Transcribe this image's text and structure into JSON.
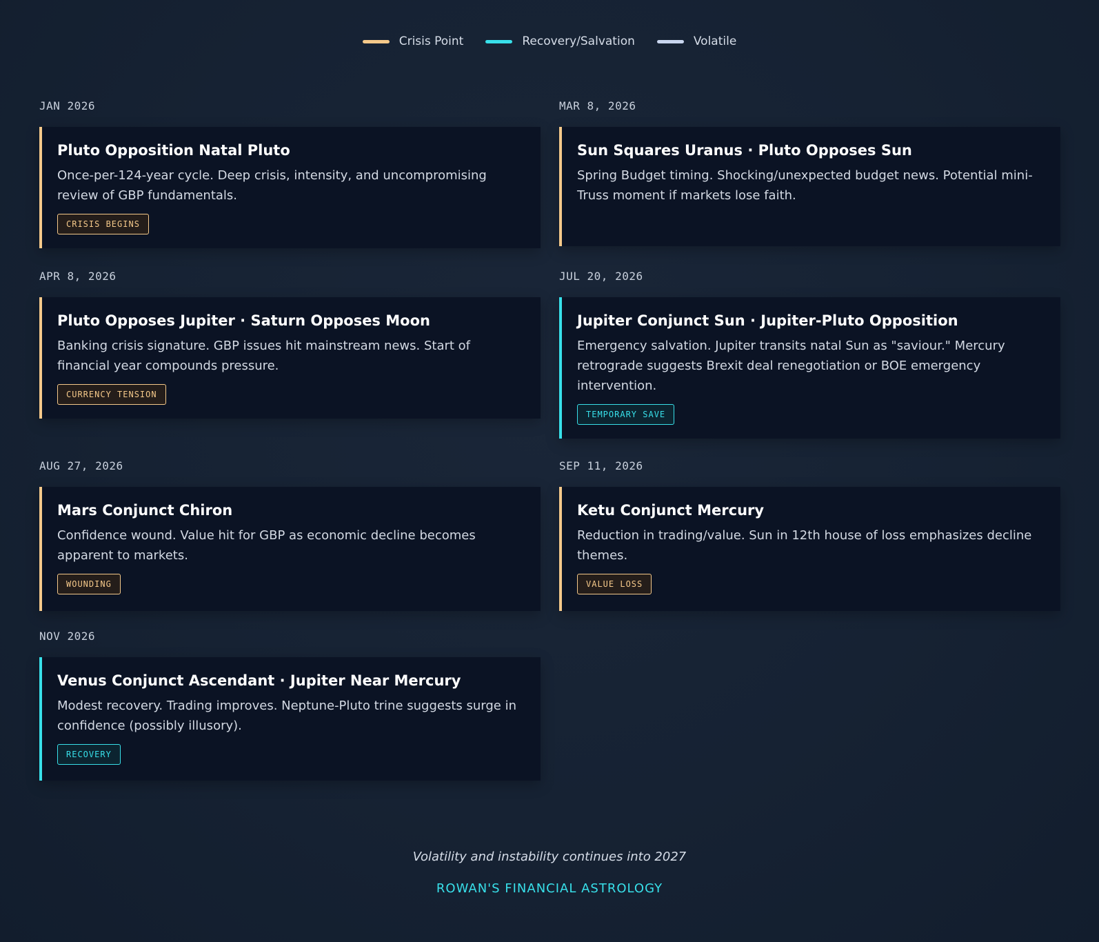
{
  "legend": {
    "items": [
      {
        "label": "Crisis Point",
        "color": "#f5c98a"
      },
      {
        "label": "Recovery/Salvation",
        "color": "#38e0ea"
      },
      {
        "label": "Volatile",
        "color": "#c9d6ef"
      }
    ]
  },
  "events": [
    {
      "date": "JAN 2026",
      "title": "Pluto Opposition Natal Pluto",
      "description": "Once-per-124-year cycle. Deep crisis, intensity, and uncompromising review of GBP fundamentals.",
      "tag": "CRISIS BEGINS",
      "type": "crisis"
    },
    {
      "date": "MAR 8, 2026",
      "title": "Sun Squares Uranus · Pluto Opposes Sun",
      "description": "Spring Budget timing. Shocking/unexpected budget news. Potential mini-Truss moment if markets lose faith.",
      "tag": "",
      "type": "crisis"
    },
    {
      "date": "APR 8, 2026",
      "title": "Pluto Opposes Jupiter · Saturn Opposes Moon",
      "description": "Banking crisis signature. GBP issues hit mainstream news. Start of financial year compounds pressure.",
      "tag": "CURRENCY TENSION",
      "type": "crisis"
    },
    {
      "date": "JUL 20, 2026",
      "title": "Jupiter Conjunct Sun · Jupiter-Pluto Opposition",
      "description": "Emergency salvation. Jupiter transits natal Sun as \"saviour.\" Mercury retrograde suggests Brexit deal renegotiation or BOE emergency intervention.",
      "tag": "TEMPORARY SAVE",
      "type": "recovery"
    },
    {
      "date": "AUG 27, 2026",
      "title": "Mars Conjunct Chiron",
      "description": "Confidence wound. Value hit for GBP as economic decline becomes apparent to markets.",
      "tag": "WOUNDING",
      "type": "crisis"
    },
    {
      "date": "SEP 11, 2026",
      "title": "Ketu Conjunct Mercury",
      "description": "Reduction in trading/value. Sun in 12th house of loss emphasizes decline themes.",
      "tag": "VALUE LOSS",
      "type": "crisis"
    },
    {
      "date": "NOV 2026",
      "title": "Venus Conjunct Ascendant · Jupiter Near Mercury",
      "description": "Modest recovery. Trading improves. Neptune-Pluto trine suggests surge in confidence (possibly illusory).",
      "tag": "RECOVERY",
      "type": "recovery"
    }
  ],
  "footer": {
    "note": "Volatility and instability continues into 2027",
    "brand": "ROWAN'S FINANCIAL ASTROLOGY"
  }
}
